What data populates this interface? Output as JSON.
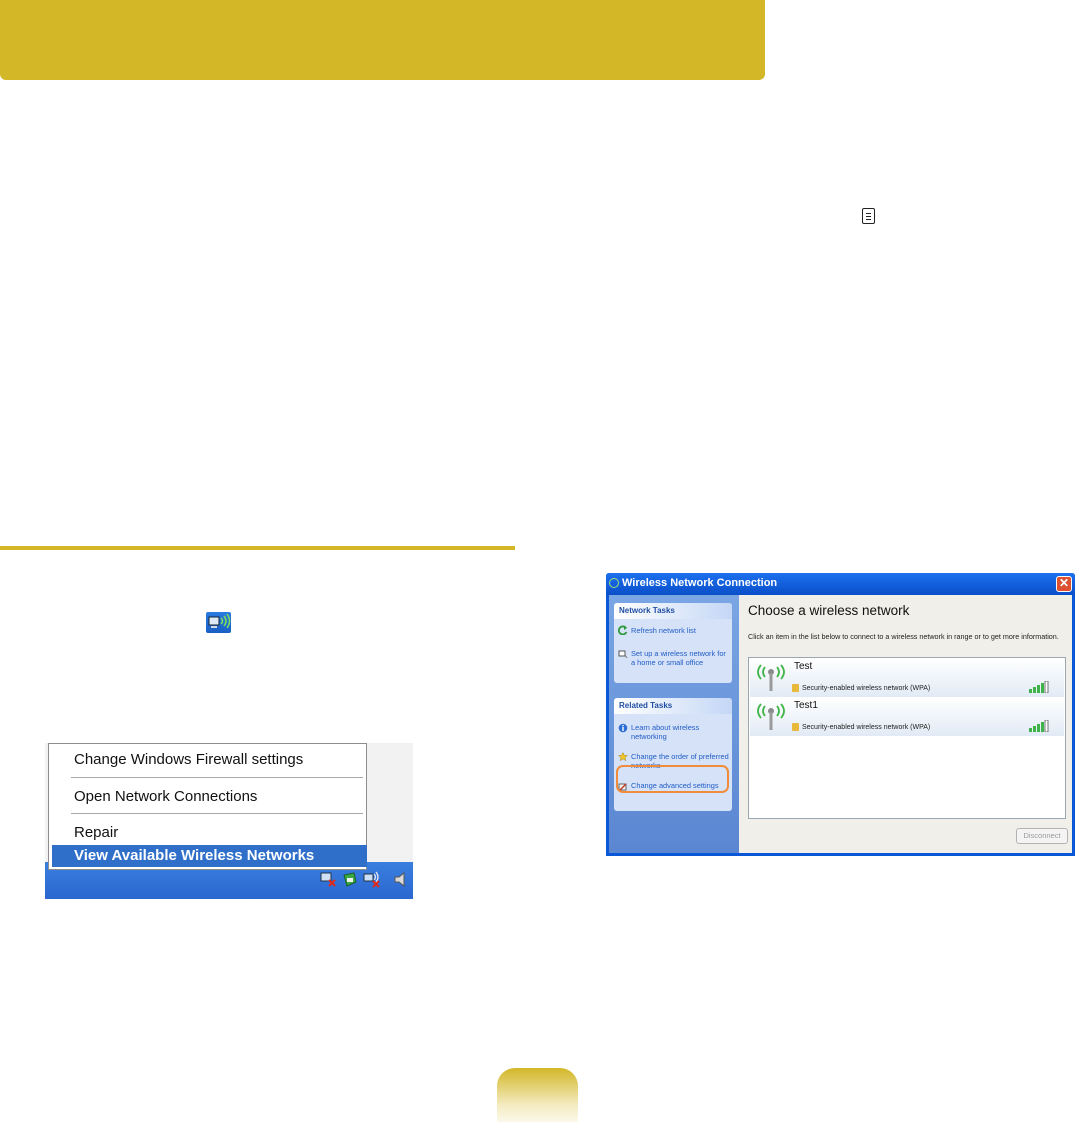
{
  "colors": {
    "accent_gold": "#d3b727",
    "xp_blue": "#0a57d8",
    "highlight_orange": "#f08c3a",
    "menu_selected": "#2f6fc9"
  },
  "icons": {
    "memo": "memo-icon",
    "tray_wireless": "wireless-network-icon"
  },
  "context_menu": {
    "items": [
      {
        "label": "Change Windows Firewall settings"
      },
      {
        "label": "Open Network Connections"
      },
      {
        "label": "Repair"
      },
      {
        "label": "View Available Wireless Networks",
        "selected": true
      }
    ]
  },
  "wireless_window": {
    "title": "Wireless Network Connection",
    "close_glyph": "✕",
    "network_tasks": {
      "heading": "Network Tasks",
      "items": [
        {
          "label": "Refresh network list"
        },
        {
          "label": "Set up a wireless network for a home or small office"
        }
      ]
    },
    "related_tasks": {
      "heading": "Related Tasks",
      "items": [
        {
          "label": "Learn about wireless networking"
        },
        {
          "label": "Change the order of preferred networks",
          "highlighted": true
        },
        {
          "label": "Change advanced settings"
        }
      ]
    },
    "heading": "Choose a wireless network",
    "instructions": "Click an item in the list below to connect to a wireless network in range or to get more information.",
    "networks": [
      {
        "name": "Test",
        "security": "Security-enabled wireless network (WPA)",
        "signal_bars": 4
      },
      {
        "name": "Test1",
        "security": "Security-enabled wireless network (WPA)",
        "signal_bars": 4
      }
    ],
    "disconnect_label": "Disconnect"
  }
}
